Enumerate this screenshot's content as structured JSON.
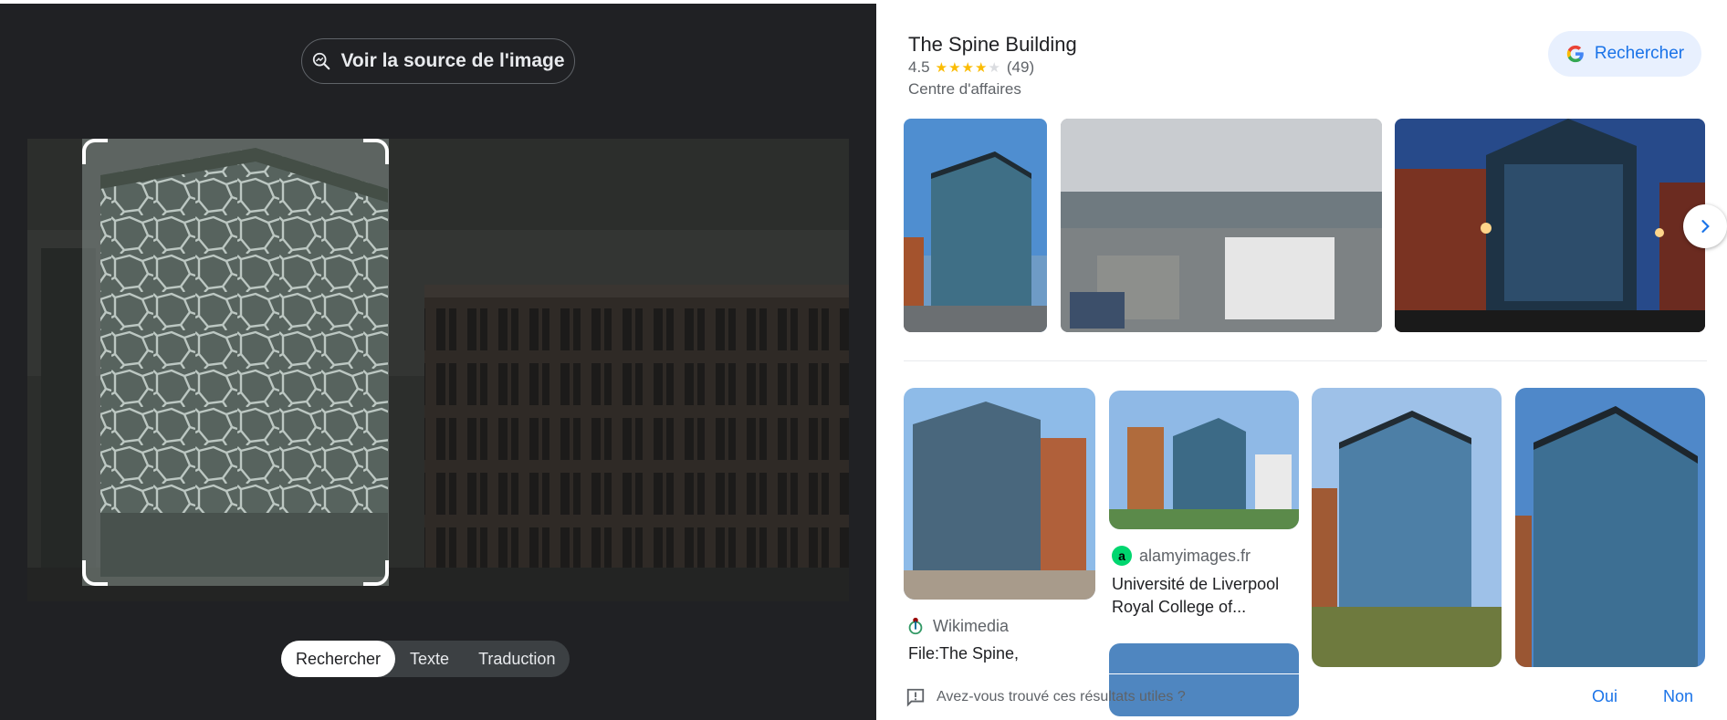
{
  "left": {
    "source_button_label": "Voir la source de l'image",
    "modes": [
      {
        "label": "Rechercher",
        "active": true
      },
      {
        "label": "Texte",
        "active": false
      },
      {
        "label": "Traduction",
        "active": false
      }
    ]
  },
  "place": {
    "title": "The Spine Building",
    "rating": "4.5",
    "review_count": "(49)",
    "category": "Centre d'affaires",
    "search_button_label": "Rechercher"
  },
  "results": [
    {
      "source": "Wikimedia",
      "title": "File:The Spine,"
    },
    {
      "source": "alamyimages.fr",
      "title": "Université de Liverpool Royal College of..."
    }
  ],
  "feedback": {
    "question": "Avez-vous trouvé ces résultats utiles ?",
    "yes": "Oui",
    "no": "Non"
  },
  "colors": {
    "accent": "#1a73e8",
    "star": "#fbbc04",
    "dark_bg": "#202124"
  }
}
